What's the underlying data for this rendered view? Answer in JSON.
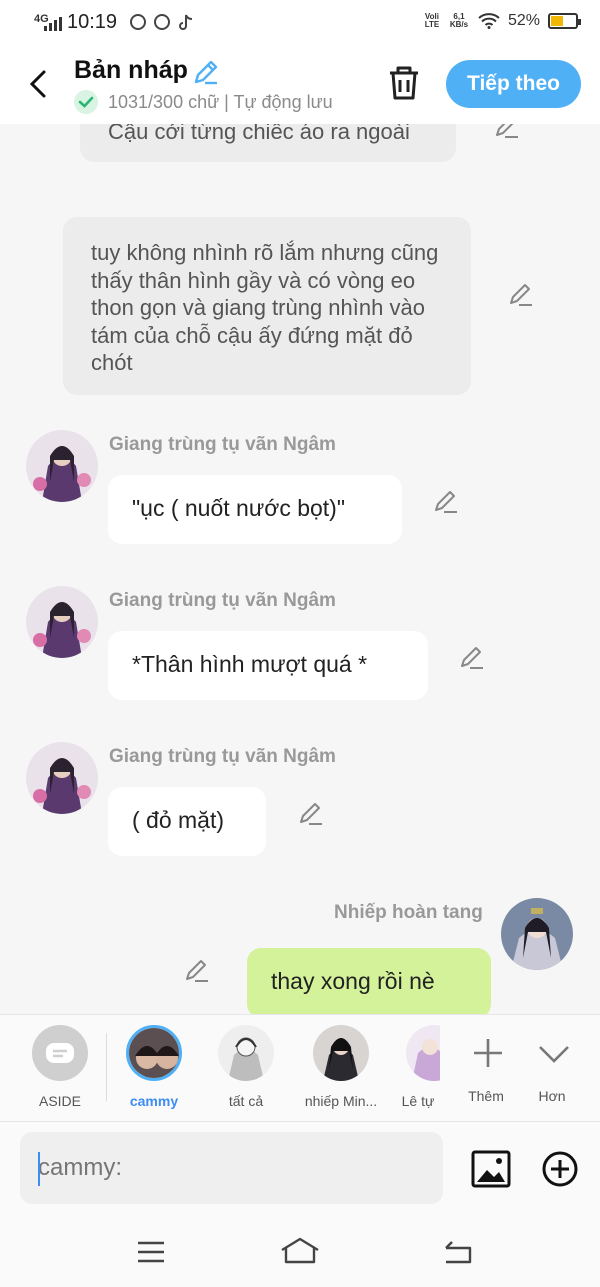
{
  "status": {
    "network": "4G",
    "time": "10:19",
    "volte": "Voli LTE",
    "speed": "6,1 KB/s",
    "battery": "52%",
    "battery_level": 0.52
  },
  "header": {
    "title": "Bản nháp",
    "subtitle": "1031/300 chữ | Tự động lưu",
    "next_label": "Tiếp theo"
  },
  "messages": [
    {
      "type": "narration",
      "text": "Cậu cởi từng chiếc áo ra ngoài"
    },
    {
      "type": "narration",
      "text": "tuy không nhình rõ lắm nhưng cũng thấy thân hình gầy và có vòng eo thon gọn và giang trùng nhình vào tám của chỗ cậu ấy đứng mặt đỏ chót"
    },
    {
      "type": "left",
      "name": "Giang trùng tụ vãn Ngâm",
      "text": "\"ục ( nuốt nước bọt)\""
    },
    {
      "type": "left",
      "name": "Giang trùng tụ vãn Ngâm",
      "text": "*Thân hình mượt quá *"
    },
    {
      "type": "left",
      "name": "Giang trùng tụ vãn Ngâm",
      "text": "( đỏ mặt)"
    },
    {
      "type": "right",
      "name": "Nhiếp hoàn tang",
      "text": "thay xong rồi nè"
    }
  ],
  "characters": [
    {
      "label": "ASIDE",
      "icon": "aside-icon"
    },
    {
      "label": "cammy",
      "selected": true
    },
    {
      "label": "tất cả"
    },
    {
      "label": "nhiếp Min..."
    },
    {
      "label": "Lê tự"
    },
    {
      "label": "Thêm",
      "icon": "plus-icon"
    },
    {
      "label": "Hơn",
      "icon": "chevron-down-icon"
    }
  ],
  "input": {
    "placeholder": "cammy:"
  },
  "colors": {
    "accent": "#4fb0f6",
    "right_bubble": "#d3f29a",
    "narration_bubble": "#ececec"
  }
}
